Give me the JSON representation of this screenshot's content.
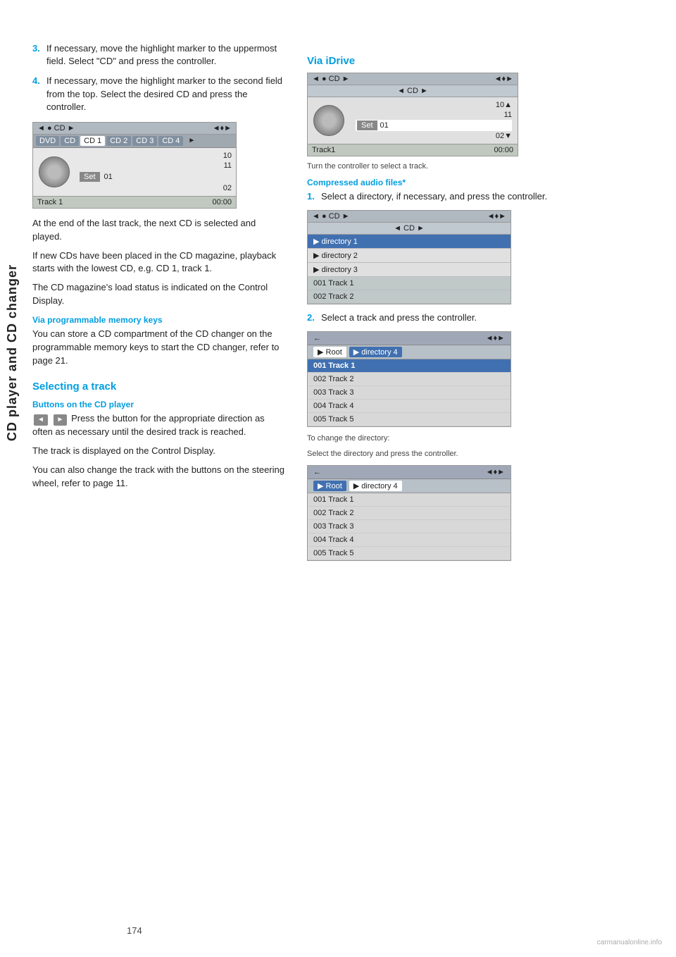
{
  "sidebar": {
    "label": "CD player and CD changer"
  },
  "page_number": "174",
  "watermark": "carmanualonline.info",
  "left_col": {
    "steps": [
      {
        "num": "3.",
        "text": "If necessary, move the highlight marker to the uppermost field. Select \"CD\" and press the controller."
      },
      {
        "num": "4.",
        "text": "If necessary, move the highlight marker to the second field from the top. Select the desired CD and press the controller."
      }
    ],
    "cd_screen": {
      "top_bar_left": "◄ ● CD ►",
      "top_bar_right": "◄♦►",
      "second_bar": "◄ CD ►",
      "tabs": [
        "DVD",
        "CD",
        "CD 1",
        "CD 2",
        "CD 3",
        "CD 4",
        "►"
      ],
      "active_tab": "CD 1",
      "tracks": [
        "10",
        "11",
        "01",
        "02"
      ],
      "highlighted_track": "01",
      "set_label": "Set",
      "footer_left": "Track 1",
      "footer_right": "00:00"
    },
    "body_texts": [
      "At the end of the last track, the next CD is selected and played.",
      "If new CDs have been placed in the CD magazine, playback starts with the lowest CD, e.g. CD 1, track 1.",
      "The CD magazine's load status is indicated on the Control Display."
    ],
    "via_programmable_heading": "Via programmable memory keys",
    "via_programmable_text": "You can store a CD compartment of the CD changer on the programmable memory keys to start the CD changer, refer to page 21.",
    "selecting_track_heading": "Selecting a track",
    "buttons_heading": "Buttons on the CD player",
    "buttons_text": "Press the button for the appropriate direction as often as necessary until the desired track is reached.",
    "buttons_text2": "The track is displayed on the Control Display.",
    "buttons_text3": "You can also change the track with the buttons on the steering wheel, refer to page 11."
  },
  "right_col": {
    "via_idrive_heading": "Via iDrive",
    "idrive_screen": {
      "top_bar_left": "◄ ● CD ►",
      "top_bar_right": "◄♦►",
      "second_bar": "◄ CD ►",
      "tracks": [
        "10▲",
        "11",
        "Set  01",
        "02▼"
      ],
      "highlighted_track": "01",
      "footer_left": "Track1",
      "footer_right": "00:00"
    },
    "turn_text": "Turn the controller to select a track.",
    "compressed_heading": "Compressed audio files*",
    "compressed_steps": [
      {
        "num": "1.",
        "text": "Select a directory, if necessary, and press the controller."
      }
    ],
    "dir_screen": {
      "top_bar_left": "◄ ● CD ►",
      "top_bar_right": "◄♦►",
      "second_bar": "◄ CD ►",
      "rows": [
        {
          "label": "▶ directory 1",
          "highlighted": true
        },
        {
          "label": "▶ directory 2",
          "highlighted": false
        },
        {
          "label": "▶ directory 3",
          "highlighted": false
        },
        {
          "label": "001 Track  1",
          "highlighted": false
        },
        {
          "label": "002 Track  2",
          "highlighted": false
        }
      ]
    },
    "step2_text": "Select a track and press the controller.",
    "track_screen1": {
      "header_left": "←",
      "header_right": "◄♦►",
      "breadcrumb": [
        "▶ Root",
        "▶ directory 4"
      ],
      "active_breadcrumb": "▶ directory 4",
      "rows": [
        {
          "label": "001 Track  1",
          "highlighted": true
        },
        {
          "label": "002 Track  2",
          "highlighted": false
        },
        {
          "label": "003 Track  3",
          "highlighted": false
        },
        {
          "label": "004 Track  4",
          "highlighted": false
        },
        {
          "label": "005 Track  5",
          "highlighted": false
        }
      ]
    },
    "change_dir_text": "To change the directory:",
    "change_dir_text2": "Select the directory and press the controller.",
    "track_screen2": {
      "header_left": "←",
      "header_right": "◄♦►",
      "breadcrumb": [
        "▶ Root",
        "▶ directory 4"
      ],
      "active_breadcrumb": "▶ Root",
      "rows": [
        {
          "label": "001 Track  1",
          "highlighted": false
        },
        {
          "label": "002 Track  2",
          "highlighted": false
        },
        {
          "label": "003 Track  3",
          "highlighted": false
        },
        {
          "label": "004 Track  4",
          "highlighted": false
        },
        {
          "label": "005 Track  5",
          "highlighted": false
        }
      ]
    }
  }
}
